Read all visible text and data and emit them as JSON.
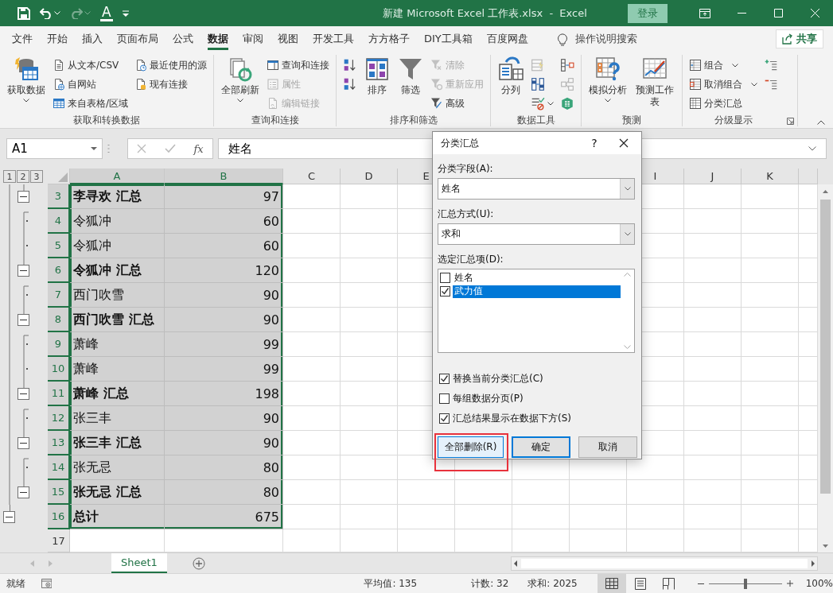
{
  "title_bar": {
    "quick_access": [
      {
        "kind": "save",
        "disabled": false
      },
      {
        "kind": "undo",
        "disabled": false
      },
      {
        "kind": "redo",
        "disabled": true
      },
      {
        "kind": "font_color",
        "glyph": "A",
        "disabled": false
      },
      {
        "kind": "customize",
        "disabled": false
      }
    ],
    "title": "新建 Microsoft Excel 工作表.xlsx  -  Excel",
    "sign_in": "登录"
  },
  "tabs": [
    {
      "label": "文件",
      "selected": false
    },
    {
      "label": "开始",
      "selected": false
    },
    {
      "label": "插入",
      "selected": false
    },
    {
      "label": "页面布局",
      "selected": false
    },
    {
      "label": "公式",
      "selected": false
    },
    {
      "label": "数据",
      "selected": true
    },
    {
      "label": "审阅",
      "selected": false
    },
    {
      "label": "视图",
      "selected": false
    },
    {
      "label": "开发工具",
      "selected": false
    },
    {
      "label": "方方格子",
      "selected": false
    },
    {
      "label": "DIY工具箱",
      "selected": false
    },
    {
      "label": "百度网盘",
      "selected": false
    }
  ],
  "tell_me": "操作说明搜索",
  "share": "共享",
  "ribbon": [
    {
      "label": "获取和转换数据",
      "items": [
        {
          "kind": "large",
          "label": "获取数据",
          "menu": true,
          "disabled": false
        },
        {
          "kind": "small",
          "label": "从文本/CSV",
          "disabled": false
        },
        {
          "kind": "small",
          "label": "自网站",
          "disabled": false
        },
        {
          "kind": "small",
          "label": "来自表格/区域",
          "disabled": false
        },
        {
          "kind": "small",
          "label": "最近使用的源",
          "disabled": false
        },
        {
          "kind": "small",
          "label": "现有连接",
          "disabled": false
        }
      ]
    },
    {
      "label": "查询和连接",
      "items": [
        {
          "kind": "large",
          "label": "全部刷新",
          "menu": true,
          "disabled": false
        },
        {
          "kind": "small",
          "label": "查询和连接",
          "disabled": false
        },
        {
          "kind": "small",
          "label": "属性",
          "disabled": true
        },
        {
          "kind": "small",
          "label": "编辑链接",
          "disabled": true
        }
      ]
    },
    {
      "label": "排序和筛选",
      "items": [
        {
          "kind": "icon",
          "disabled": false
        },
        {
          "kind": "icon",
          "disabled": false
        },
        {
          "kind": "large",
          "label": "排序",
          "disabled": false
        },
        {
          "kind": "large",
          "label": "筛选",
          "disabled": false
        },
        {
          "kind": "small",
          "label": "清除",
          "disabled": true
        },
        {
          "kind": "small",
          "label": "重新应用",
          "disabled": true
        },
        {
          "kind": "small",
          "label": "高级",
          "disabled": false
        }
      ]
    },
    {
      "label": "数据工具",
      "items": [
        {
          "kind": "large",
          "label": "分列",
          "disabled": false
        },
        {
          "kind": "icon",
          "disabled": true
        },
        {
          "kind": "icon",
          "disabled": false
        },
        {
          "kind": "icon",
          "menu": true,
          "disabled": false
        },
        {
          "kind": "icon",
          "disabled": false
        },
        {
          "kind": "icon",
          "disabled": true
        },
        {
          "kind": "icon",
          "disabled": false
        }
      ]
    },
    {
      "label": "预测",
      "items": [
        {
          "kind": "large",
          "label": "模拟分析",
          "menu": true,
          "disabled": false
        },
        {
          "kind": "large",
          "label": "预测工作表",
          "disabled": false
        }
      ]
    },
    {
      "label": "分级显示",
      "items": [
        {
          "kind": "small",
          "label": "组合",
          "menu": true,
          "disabled": false
        },
        {
          "kind": "small",
          "label": "取消组合",
          "menu": true,
          "disabled": false
        },
        {
          "kind": "small",
          "label": "分类汇总",
          "disabled": false
        },
        {
          "kind": "icon",
          "disabled": false
        },
        {
          "kind": "icon",
          "disabled": false
        }
      ]
    }
  ],
  "formula_bar": {
    "name_box": "A1",
    "fx": "fx",
    "formula": "姓名"
  },
  "outline_levels": [
    "1",
    "2",
    "3"
  ],
  "column_headers": [
    {
      "label": "A",
      "selected": true
    },
    {
      "label": "B",
      "selected": true
    },
    {
      "label": "C",
      "selected": false
    },
    {
      "label": "D",
      "selected": false
    },
    {
      "label": "E",
      "selected": false
    },
    {
      "label": "I",
      "selected": false
    },
    {
      "label": "J",
      "selected": false
    },
    {
      "label": "K",
      "selected": false
    }
  ],
  "rows": [
    {
      "number": "3",
      "kind": "subtotal",
      "name": "李寻欢 汇总",
      "value": "97",
      "selected": true
    },
    {
      "number": "4",
      "kind": "detail",
      "name": "令狐冲",
      "value": "60",
      "selected": true
    },
    {
      "number": "5",
      "kind": "detail",
      "name": "令狐冲",
      "value": "60",
      "selected": true
    },
    {
      "number": "6",
      "kind": "subtotal",
      "name": "令狐冲 汇总",
      "value": "120",
      "selected": true
    },
    {
      "number": "7",
      "kind": "detail",
      "name": "西门吹雪",
      "value": "90",
      "selected": true
    },
    {
      "number": "8",
      "kind": "subtotal",
      "name": "西门吹雪 汇总",
      "value": "90",
      "selected": true
    },
    {
      "number": "9",
      "kind": "detail",
      "name": "萧峰",
      "value": "99",
      "selected": true
    },
    {
      "number": "10",
      "kind": "detail",
      "name": "萧峰",
      "value": "99",
      "selected": true
    },
    {
      "number": "11",
      "kind": "subtotal",
      "name": "萧峰 汇总",
      "value": "198",
      "selected": true
    },
    {
      "number": "12",
      "kind": "detail",
      "name": "张三丰",
      "value": "90",
      "selected": true
    },
    {
      "number": "13",
      "kind": "subtotal",
      "name": "张三丰 汇总",
      "value": "90",
      "selected": true
    },
    {
      "number": "14",
      "kind": "detail",
      "name": "张无忌",
      "value": "80",
      "selected": true
    },
    {
      "number": "15",
      "kind": "subtotal",
      "name": "张无忌 汇总",
      "value": "80",
      "selected": true
    },
    {
      "number": "16",
      "kind": "total",
      "name": "总计",
      "value": "675",
      "selected": true
    },
    {
      "number": "17",
      "kind": "empty",
      "selected": false
    }
  ],
  "dialog": {
    "title": "分类汇总",
    "help": "?",
    "fields": [
      {
        "label": "分类字段(A):",
        "value": "姓名"
      },
      {
        "label": "汇总方式(U):",
        "value": "求和"
      }
    ],
    "list_label": "选定汇总项(D):",
    "list_items": [
      {
        "label": "姓名",
        "checked": false,
        "selected": false
      },
      {
        "label": "武力值",
        "checked": true,
        "selected": true
      }
    ],
    "options": [
      {
        "label": "替换当前分类汇总(C)",
        "checked": true
      },
      {
        "label": "每组数据分页(P)",
        "checked": false
      },
      {
        "label": "汇总结果显示在数据下方(S)",
        "checked": true
      }
    ],
    "buttons": [
      {
        "label": "全部删除(R)",
        "kind": "focused",
        "annotated": true
      },
      {
        "label": "确定",
        "kind": "default"
      },
      {
        "label": "取消",
        "kind": "normal"
      }
    ]
  },
  "sheet_tabs": [
    {
      "label": "Sheet1",
      "selected": true
    }
  ],
  "status_bar": {
    "mode": "就绪",
    "stats": [
      "平均值: 135",
      "计数: 32",
      "求和: 2025"
    ],
    "views": [
      {
        "kind": "normal",
        "selected": true
      },
      {
        "kind": "page_layout",
        "selected": false
      },
      {
        "kind": "page_break",
        "selected": false
      }
    ],
    "zoom": {
      "level": 0.5,
      "reading": "100%"
    }
  }
}
